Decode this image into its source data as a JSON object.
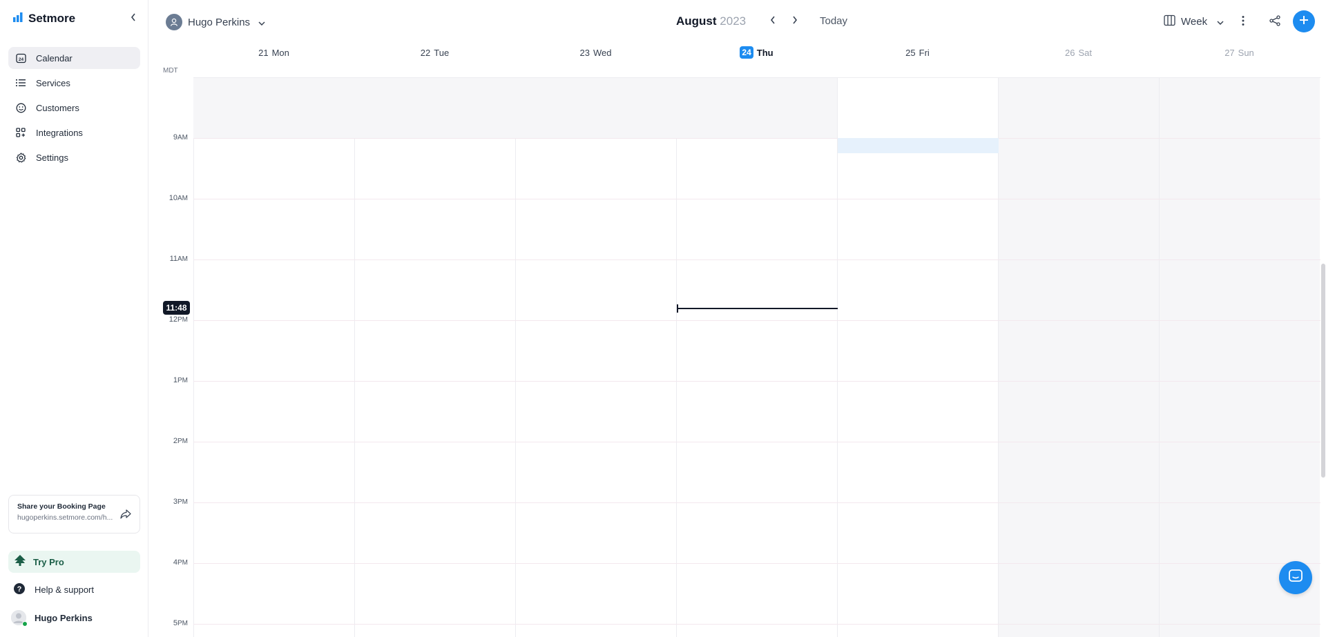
{
  "brand": {
    "name": "Setmore"
  },
  "sidebar": {
    "items": [
      {
        "label": "Calendar",
        "icon": "calendar-24-icon",
        "active": true
      },
      {
        "label": "Services",
        "icon": "list-icon",
        "active": false
      },
      {
        "label": "Customers",
        "icon": "smiley-icon",
        "active": false
      },
      {
        "label": "Integrations",
        "icon": "grid-plus-icon",
        "active": false
      },
      {
        "label": "Settings",
        "icon": "gear-icon",
        "active": false
      }
    ],
    "share": {
      "title": "Share your Booking Page",
      "url": "hugoperkins.setmore.com/h..."
    },
    "try_pro": "Try Pro",
    "help": "Help & support",
    "user": "Hugo Perkins"
  },
  "header": {
    "staff": "Hugo Perkins",
    "month": "August",
    "year": "2023",
    "today": "Today",
    "view": "Week"
  },
  "days": [
    {
      "num": "21",
      "name": "Mon",
      "today": false,
      "weekend": false
    },
    {
      "num": "22",
      "name": "Tue",
      "today": false,
      "weekend": false
    },
    {
      "num": "23",
      "name": "Wed",
      "today": false,
      "weekend": false
    },
    {
      "num": "24",
      "name": "Thu",
      "today": true,
      "weekend": false
    },
    {
      "num": "25",
      "name": "Fri",
      "today": false,
      "weekend": false
    },
    {
      "num": "26",
      "name": "Sat",
      "today": false,
      "weekend": true
    },
    {
      "num": "27",
      "name": "Sun",
      "today": false,
      "weekend": true
    }
  ],
  "timezone": "MDT",
  "hours": [
    {
      "n": "9",
      "s": "AM"
    },
    {
      "n": "10",
      "s": "AM"
    },
    {
      "n": "11",
      "s": "AM"
    },
    {
      "n": "12",
      "s": "PM"
    },
    {
      "n": "1",
      "s": "PM"
    },
    {
      "n": "2",
      "s": "PM"
    },
    {
      "n": "3",
      "s": "PM"
    },
    {
      "n": "4",
      "s": "PM"
    },
    {
      "n": "5",
      "s": "PM"
    }
  ],
  "now_time": "11:48",
  "colors": {
    "accent": "#1d8cf0",
    "pro_green": "#1b5e47"
  }
}
